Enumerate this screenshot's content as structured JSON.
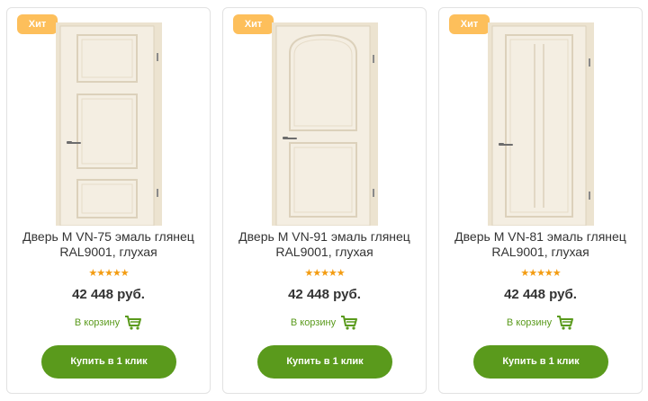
{
  "colors": {
    "badge": "#fdbf5b",
    "accent_green": "#5a9a1c",
    "stars": "#f39c12",
    "door_fill": "#f3ecdd",
    "door_frame": "#ece3d0"
  },
  "products": [
    {
      "badge": "Хит",
      "title_line1": "Дверь M VN-75 эмаль глянец",
      "title_line2": "RAL9001, глухая",
      "rating": "★★★★★",
      "price": "42 448 руб.",
      "cart_label": "В корзину",
      "cart_icon": "shopping-cart-icon",
      "buy_label": "Купить в 1 клик",
      "door_style": "three-panels"
    },
    {
      "badge": "Хит",
      "title_line1": "Дверь M VN-91 эмаль глянец",
      "title_line2": "RAL9001, глухая",
      "rating": "★★★★★",
      "price": "42 448 руб.",
      "cart_label": "В корзину",
      "cart_icon": "shopping-cart-icon",
      "buy_label": "Купить в 1 клик",
      "door_style": "two-panels"
    },
    {
      "badge": "Хит",
      "title_line1": "Дверь M VN-81 эмаль глянец",
      "title_line2": "RAL9001, глухая",
      "rating": "★★★★★",
      "price": "42 448 руб.",
      "cart_label": "В корзину",
      "cart_icon": "shopping-cart-icon",
      "buy_label": "Купить в 1 клик",
      "door_style": "vertical-lines"
    }
  ]
}
